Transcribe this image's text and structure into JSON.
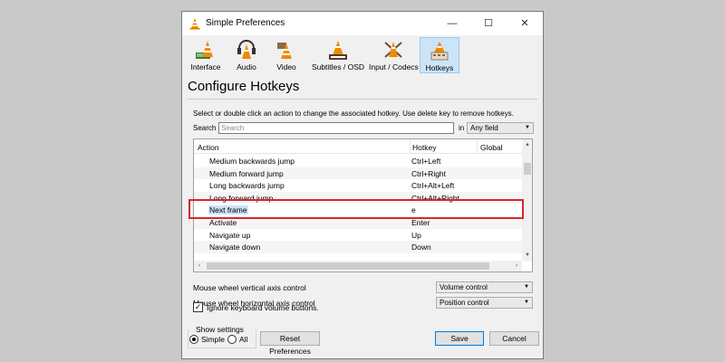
{
  "window": {
    "title": "Simple Preferences",
    "minimize_glyph": "—",
    "maximize_glyph": "☐",
    "close_glyph": "✕"
  },
  "tabs": [
    {
      "label": "Interface",
      "icon": "interface-cone-icon",
      "active": false
    },
    {
      "label": "Audio",
      "icon": "audio-cone-icon",
      "active": false
    },
    {
      "label": "Video",
      "icon": "video-cone-icon",
      "active": false
    },
    {
      "label": "Subtitles / OSD",
      "icon": "subtitles-cone-icon",
      "active": false
    },
    {
      "label": "Input / Codecs",
      "icon": "input-cone-icon",
      "active": false
    },
    {
      "label": "Hotkeys",
      "icon": "hotkeys-cone-icon",
      "active": true
    }
  ],
  "heading": "Configure Hotkeys",
  "instructions": "Select or double click an action to change the associated hotkey. Use delete key to remove hotkeys.",
  "search": {
    "label": "Search",
    "placeholder": "Search",
    "value": "",
    "in_label": "in",
    "field": "Any field"
  },
  "table": {
    "columns": [
      "Action",
      "Hotkey",
      "Global"
    ],
    "rows": [
      {
        "action": "Medium backwards jump",
        "hotkey": "Ctrl+Left"
      },
      {
        "action": "Medium forward jump",
        "hotkey": "Ctrl+Right"
      },
      {
        "action": "Long backwards jump",
        "hotkey": "Ctrl+Alt+Left"
      },
      {
        "action": "Long forward jump",
        "hotkey": "Ctrl+Alt+Right"
      },
      {
        "action": "Next frame",
        "hotkey": "e",
        "selected": true
      },
      {
        "action": "Activate",
        "hotkey": "Enter"
      },
      {
        "action": "Navigate up",
        "hotkey": "Up"
      },
      {
        "action": "Navigate down",
        "hotkey": "Down"
      }
    ]
  },
  "mouse": {
    "vertical_label": "Mouse wheel vertical axis control",
    "vertical_value": "Volume control",
    "horizontal_label": "Mouse wheel horizontal axis control",
    "horizontal_value": "Position control"
  },
  "ignore_keyboard": {
    "label": "Ignore keyboard volume buttons.",
    "checked": true
  },
  "show_settings": {
    "label": "Show settings",
    "simple": "Simple",
    "all": "All",
    "selected": "Simple"
  },
  "buttons": {
    "reset": "Reset Preferences",
    "save": "Save",
    "cancel": "Cancel"
  },
  "colors": {
    "highlight_box": "#d8262c",
    "active_tab": "#cce4f7",
    "cone_orange": "#f08a00"
  }
}
